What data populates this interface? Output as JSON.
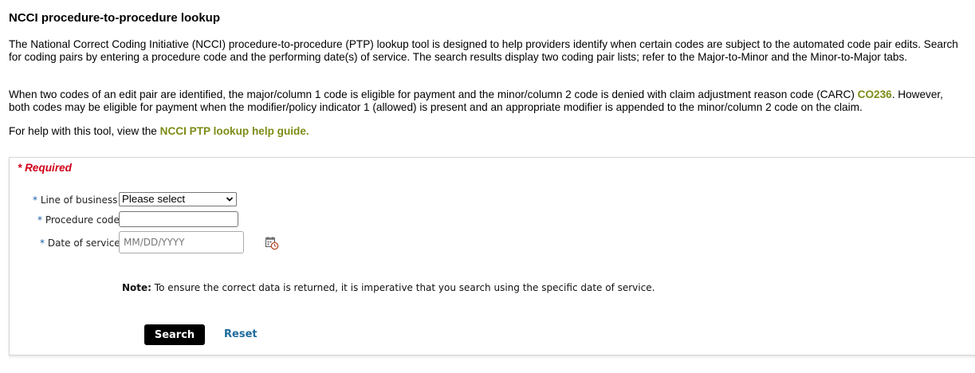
{
  "header": {
    "title": "NCCI procedure-to-procedure lookup"
  },
  "intro": {
    "paragraph1": "The National Correct Coding Initiative (NCCI) procedure-to-procedure (PTP) lookup tool is designed to help providers identify when certain codes are subject to the automated code pair edits. Search for coding pairs by entering a procedure code and the performing date(s) of service. The search results display two coding pair lists; refer to the Major-to-Minor and the Minor-to-Major tabs.",
    "paragraph2_before": "When two codes of an edit pair are identified, the major/column 1 code is eligible for payment and the minor/column 2 code is denied with claim adjustment reason code (CARC) ",
    "paragraph2_code": "CO236",
    "paragraph2_after": ". However, both codes may be eligible for payment when the modifier/policy indicator 1 (allowed) is present and an appropriate modifier is appended to the minor/column 2 code on the claim.",
    "help_prefix": "For help with this tool, view the ",
    "help_link": "NCCI PTP lookup help guide."
  },
  "form": {
    "required_note": "* Required",
    "required_star": "*",
    "line_of_business": {
      "label": "Line of business",
      "selected": "Please select"
    },
    "procedure_code": {
      "label": "Procedure code",
      "value": "",
      "placeholder": ""
    },
    "date_of_service": {
      "label": "Date of service",
      "value": "",
      "placeholder": "MM/DD/YYYY"
    },
    "note_label": "Note:",
    "note_text": " To ensure the correct data is returned, it is imperative that you search using the specific date of service.",
    "search_label": "Search",
    "reset_label": "Reset"
  },
  "icons": {
    "calendar": "calendar-icon",
    "dropdown": "chevron-down-icon"
  },
  "colors": {
    "link_green": "#7e8c16",
    "required_red": "#d0021b",
    "reset_blue": "#1d6a9c",
    "search_button_bg": "#000000"
  }
}
